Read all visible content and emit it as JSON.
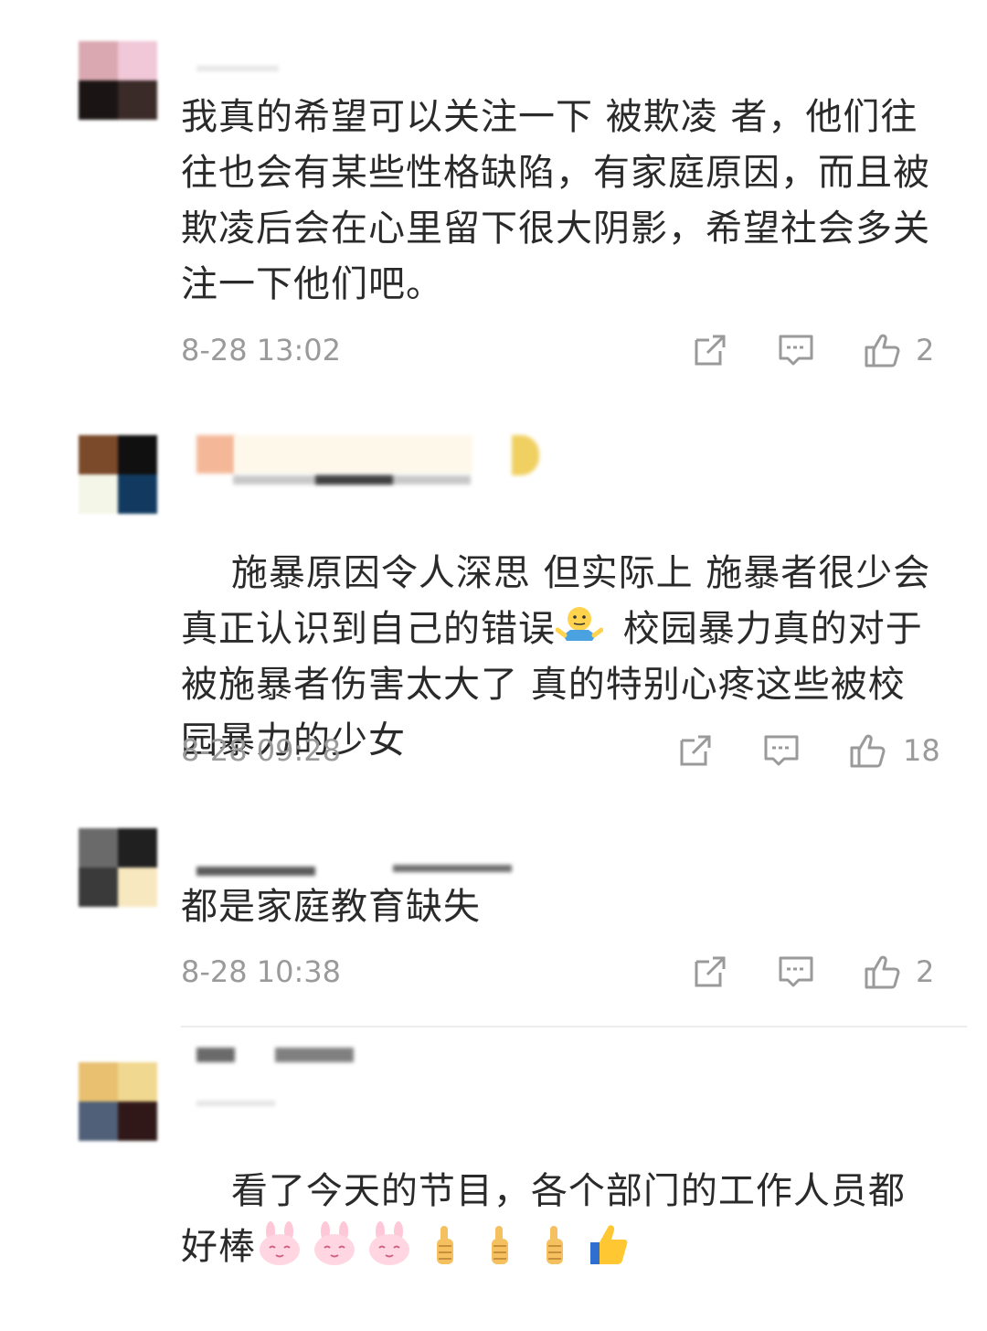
{
  "comments": [
    {
      "text": "我真的希望可以关注一下 被欺凌 者，他们往往也会有某些性格缺陷，有家庭原因，而且被欺凌后会在心里留下很大阴影，希望社会多关注一下他们吧。",
      "time": "8-28 13:02",
      "likes": "2",
      "avatar_colors": [
        "#d9a8b0",
        "#f0c8d8",
        "#1a1414",
        "#3a2a28"
      ]
    },
    {
      "text_before_emoji": "施暴原因令人深思 但实际上 施暴者很少会真正认识到自己的错误",
      "text_after_emoji": " 校园暴力真的对于被施暴者伤害太大了 真的特别心疼这些被校园暴力的少女",
      "emoji": "shrug-emoji",
      "time": "8-28 09:28",
      "likes": "18",
      "avatar_colors": [
        "#7a4a2a",
        "#101010",
        "#f4f6e8",
        "#123a60"
      ]
    },
    {
      "text": "都是家庭教育缺失",
      "time": "8-28 10:38",
      "likes": "2",
      "avatar_colors": [
        "#6a6a6a",
        "#202020",
        "#3a3a3a",
        "#f8e8c0"
      ]
    },
    {
      "text": "看了今天的节目，各个部门的工作人员都好棒",
      "emojis": [
        "bunny-emoji",
        "bunny-emoji",
        "bunny-emoji",
        "thumbs-up-emoji",
        "thumbs-up-emoji",
        "thumbs-up-emoji",
        "thumbs-up-emoji"
      ],
      "avatar_colors": [
        "#e8c070",
        "#f0d890",
        "#506078",
        "#301818"
      ]
    }
  ],
  "icons": {
    "share": "share-icon",
    "reply": "comment-icon",
    "like": "thumbs-up-icon"
  }
}
